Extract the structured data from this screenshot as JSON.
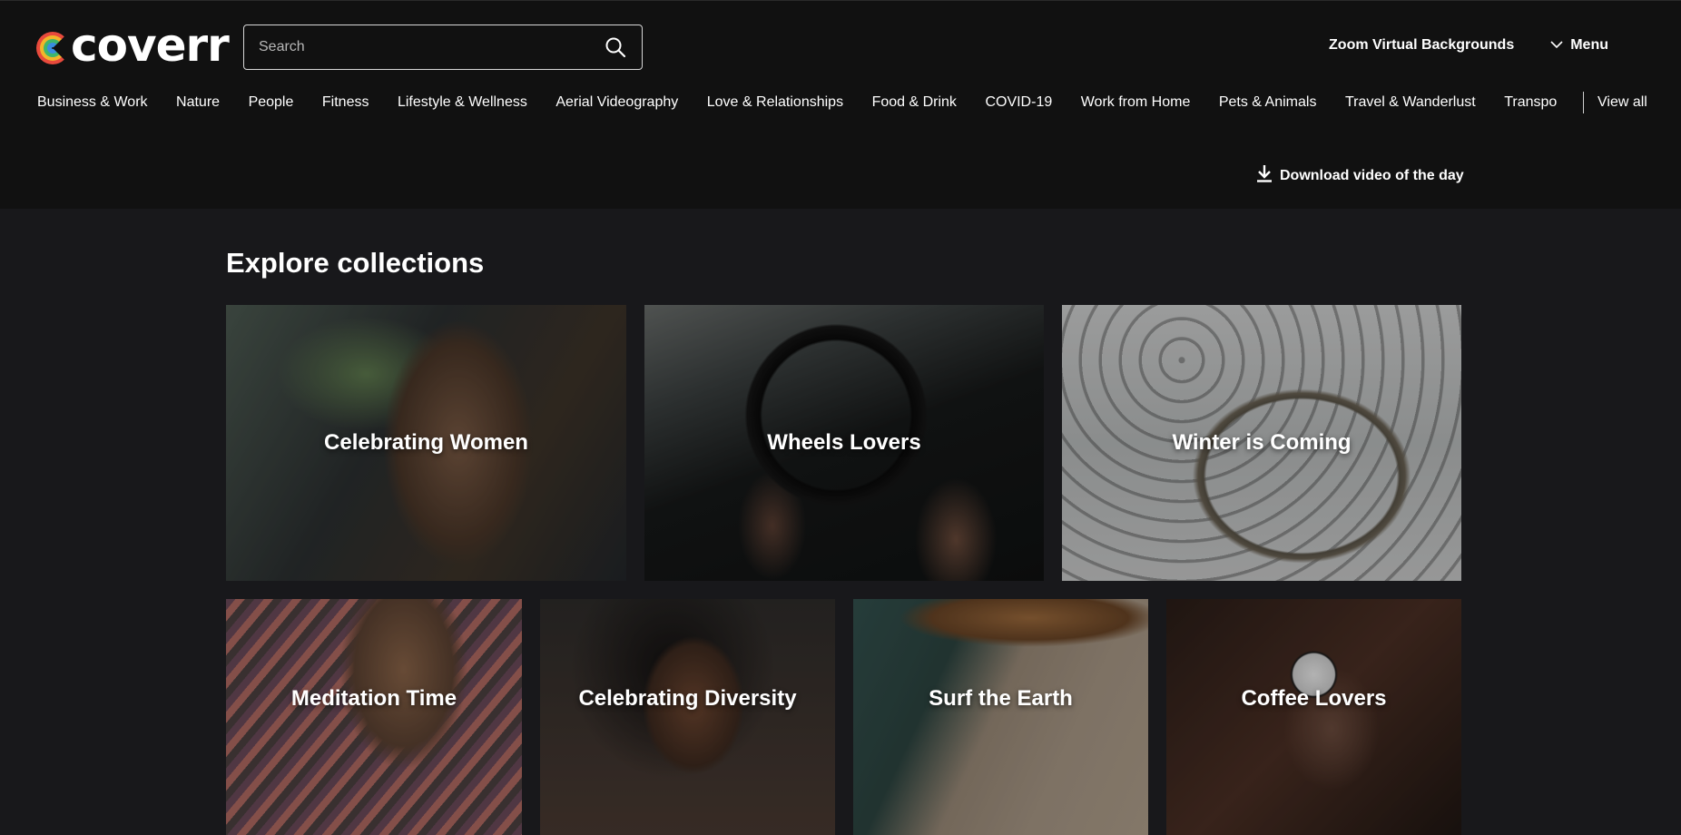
{
  "brand": {
    "name": "coverr"
  },
  "search": {
    "placeholder": "Search"
  },
  "header": {
    "zoom_link": "Zoom Virtual Backgrounds",
    "menu_label": "Menu"
  },
  "categories": [
    "Business & Work",
    "Nature",
    "People",
    "Fitness",
    "Lifestyle & Wellness",
    "Aerial Videography",
    "Love & Relationships",
    "Food & Drink",
    "COVID-19",
    "Work from Home",
    "Pets & Animals",
    "Travel & Wanderlust",
    "Transpo"
  ],
  "view_all": "View all",
  "download_video": "Download video of the day",
  "collections": {
    "title": "Explore collections",
    "items": [
      {
        "label": "Celebrating Women"
      },
      {
        "label": "Wheels Lovers"
      },
      {
        "label": "Winter is Coming"
      },
      {
        "label": "Meditation Time"
      },
      {
        "label": "Celebrating Diversity"
      },
      {
        "label": "Surf the Earth"
      },
      {
        "label": "Coffee Lovers"
      }
    ]
  },
  "colors": {
    "header_bg": "#111111",
    "page_bg": "#18181b",
    "text": "#ffffff"
  },
  "icons": {
    "search": "search-icon",
    "menu": "chevron-down-icon",
    "download": "download-icon"
  }
}
